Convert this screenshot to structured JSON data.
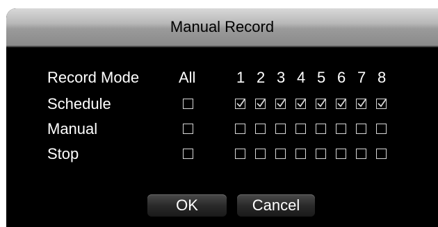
{
  "dialog": {
    "title": "Manual Record",
    "header": {
      "label": "Record Mode",
      "all": "All",
      "channels": [
        "1",
        "2",
        "3",
        "4",
        "5",
        "6",
        "7",
        "8"
      ]
    },
    "rows": [
      {
        "label": "Schedule",
        "all_checked": false,
        "channels_checked": [
          true,
          true,
          true,
          true,
          true,
          true,
          true,
          true
        ]
      },
      {
        "label": "Manual",
        "all_checked": false,
        "channels_checked": [
          false,
          false,
          false,
          false,
          false,
          false,
          false,
          false
        ]
      },
      {
        "label": "Stop",
        "all_checked": false,
        "channels_checked": [
          false,
          false,
          false,
          false,
          false,
          false,
          false,
          false
        ]
      }
    ],
    "buttons": {
      "ok": "OK",
      "cancel": "Cancel"
    }
  },
  "colors": {
    "background": "#000000",
    "text": "#ffffff",
    "checkbox_border": "#d8d8d8"
  }
}
